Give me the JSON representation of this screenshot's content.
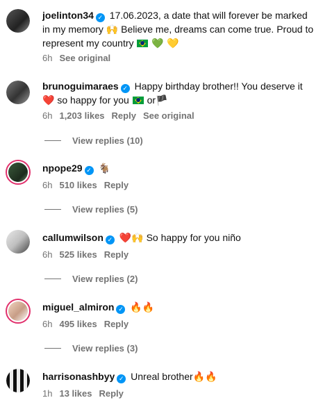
{
  "comments": [
    {
      "username": "joelinton34",
      "text_line1": "17.06.2023, a date that will forever be marked",
      "text_line2": "in my memory 🙌 Believe me, dreams can come true. Proud to",
      "text_line3": "represent my country",
      "emoji_tail": "💚 💛",
      "time": "6h",
      "see_original": "See original"
    },
    {
      "username": "brunoguimaraes",
      "text_line1": "Happy birthday brother!! You deserve it",
      "text_line2": "❤️ so happy for you",
      "text_tail": "or",
      "emoji_flag_tail": "🏴",
      "time": "6h",
      "likes": "1,203 likes",
      "reply": "Reply",
      "see_original": "See original",
      "view_replies": "View replies (10)"
    },
    {
      "username": "npope29",
      "text": "🐐",
      "time": "6h",
      "likes": "510 likes",
      "reply": "Reply",
      "view_replies": "View replies (5)"
    },
    {
      "username": "callumwilson",
      "text_emoji": "❤️🙌",
      "text": "So happy for you niño",
      "time": "6h",
      "likes": "525 likes",
      "reply": "Reply",
      "view_replies": "View replies (2)"
    },
    {
      "username": "miguel_almiron",
      "text": "🔥🔥",
      "time": "6h",
      "likes": "495 likes",
      "reply": "Reply",
      "view_replies": "View replies (3)"
    },
    {
      "username": "harrisonashbyy",
      "text": "Unreal brother🔥🔥",
      "time": "1h",
      "likes": "13 likes",
      "reply": "Reply"
    }
  ],
  "verified_icon": "verified-badge-icon",
  "colors": {
    "verified": "#0095f6",
    "meta": "#737373",
    "story_ring": "#e1306c"
  }
}
